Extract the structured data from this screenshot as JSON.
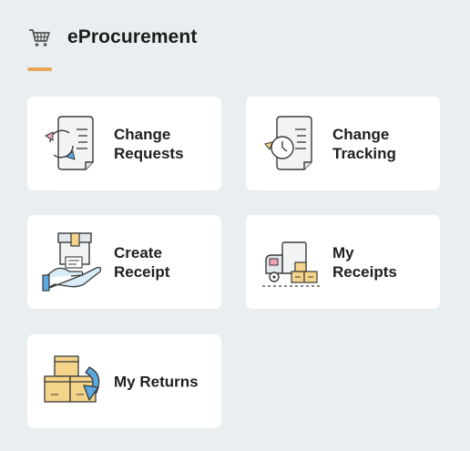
{
  "header": {
    "title": "eProcurement",
    "icon": "shopping-cart-icon",
    "accent_color": "#e8a65a"
  },
  "tiles": [
    {
      "line1": "Change",
      "line2": "Requests",
      "icon": "change-requests-icon"
    },
    {
      "line1": "Change",
      "line2": "Tracking",
      "icon": "change-tracking-icon"
    },
    {
      "line1": "Create",
      "line2": "Receipt",
      "icon": "create-receipt-icon"
    },
    {
      "line1": "My",
      "line2": "Receipts",
      "icon": "my-receipts-icon"
    },
    {
      "line1": "My Returns",
      "line2": "",
      "icon": "my-returns-icon"
    }
  ],
  "colors": {
    "background": "#e9eef0",
    "tile": "#ffffff",
    "box": "#f4d489",
    "box_stroke": "#3a3a3a",
    "blue_accent": "#5aa9e0",
    "pink_accent": "#f2a3b5"
  }
}
